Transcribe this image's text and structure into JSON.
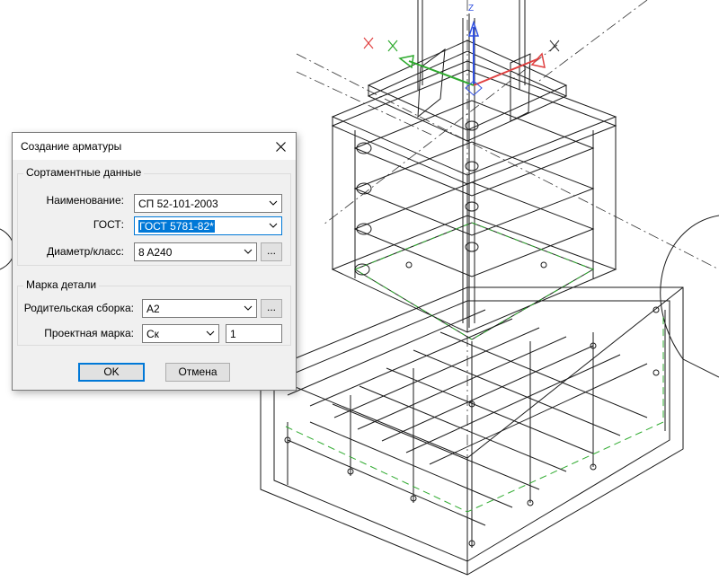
{
  "viewport": {
    "description_icon": "3d-rebar-cage-wireframe",
    "axis_label_z": "Z",
    "axis_colors": {
      "x": "#e04040",
      "y": "#2eaa2e",
      "z": "#3050e0"
    }
  },
  "dialog": {
    "title": "Создание арматуры",
    "close_icon": "close-icon",
    "group_assortment": {
      "title": "Сортаментные данные",
      "name_label": "Наименование:",
      "name_value": "СП 52-101-2003",
      "gost_label": "ГОСТ:",
      "gost_value": "ГОСТ 5781-82*",
      "diameter_label": "Диаметр/класс:",
      "diameter_value": "8 A240",
      "browse_label": "..."
    },
    "group_mark": {
      "title": "Марка детали",
      "parent_label": "Родительская сборка:",
      "parent_value": "A2",
      "browse_label": "...",
      "project_mark_label": "Проектная марка:",
      "project_mark_prefix": "Ск",
      "project_mark_number": "1"
    },
    "ok_label": "OK",
    "cancel_label": "Отмена"
  }
}
